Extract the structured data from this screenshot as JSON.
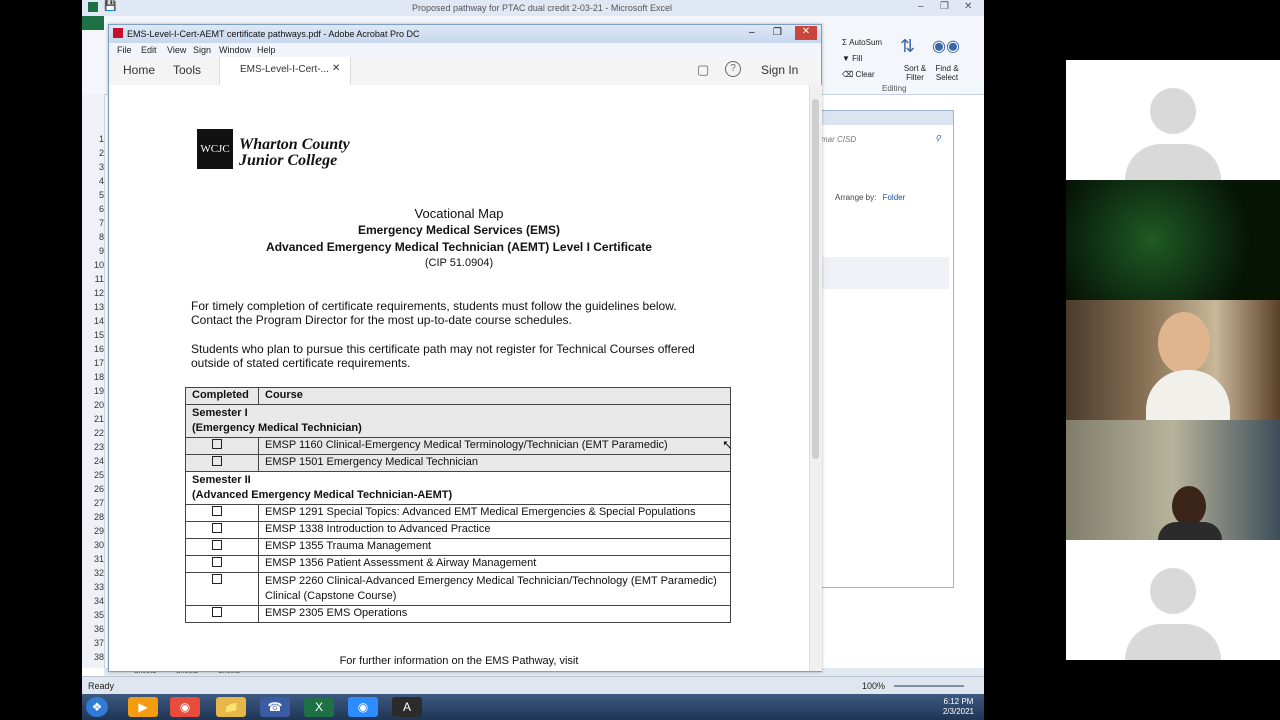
{
  "excel": {
    "title": "Proposed pathway for PTAC dual credit 2-03-21 - Microsoft Excel",
    "ribbon": {
      "autosum": "AutoSum",
      "fill": "Fill",
      "clear": "Clear",
      "sort_filter": "Sort & Filter",
      "find_select": "Find & Select",
      "group": "Editing"
    },
    "row_numbers": [
      "1",
      "2",
      "3",
      "4",
      "5",
      "6",
      "7",
      "8",
      "9",
      "10",
      "11",
      "12",
      "13",
      "14",
      "15",
      "16",
      "17",
      "18",
      "19",
      "20",
      "21",
      "22",
      "23",
      "24",
      "25",
      "26",
      "27",
      "28",
      "29",
      "30",
      "31",
      "32",
      "33",
      "34",
      "35",
      "36",
      "37",
      "38"
    ],
    "sheet_tabs": [
      "Sheet1",
      "Sheet2",
      "Sheet3"
    ],
    "status": "Ready",
    "zoom": "100%"
  },
  "side_panel": {
    "search_hint": "mar CISD",
    "arrange_by": "Arrange by:",
    "arrange_value": "Folder"
  },
  "acrobat": {
    "title": "EMS-Level-I-Cert-AEMT certificate pathways.pdf - Adobe Acrobat Pro DC",
    "menu": [
      "File",
      "Edit",
      "View",
      "Sign",
      "Window",
      "Help"
    ],
    "tabs": {
      "home": "Home",
      "tools": "Tools",
      "doc": "EMS-Level-I-Cert-..."
    },
    "sign_in": "Sign In"
  },
  "document": {
    "logo_letters": "WCJC",
    "college_line1": "Wharton County",
    "college_line2": "Junior College",
    "heading1": "Vocational Map",
    "heading2": "Emergency Medical Services (EMS)",
    "heading3": "Advanced Emergency Medical Technician (AEMT) Level I Certificate",
    "cip": "(CIP 51.0904)",
    "para1_line1": "For timely completion of certificate requirements, students must follow the guidelines below.",
    "para1_line2": "Contact the Program Director for the most up-to-date course schedules.",
    "para2_line1": "Students who plan to pursue this certificate path may not register for Technical Courses offered",
    "para2_line2": "outside of stated certificate requirements.",
    "table": {
      "col_completed": "Completed",
      "col_course": "Course",
      "sem1_line1": "Semester I",
      "sem1_line2": "(Emergency Medical Technician)",
      "sem1_courses": [
        "EMSP 1160 Clinical-Emergency Medical Terminology/Technician (EMT Paramedic)",
        "EMSP 1501 Emergency Medical Technician"
      ],
      "sem2_line1": "Semester II",
      "sem2_line2": "(Advanced Emergency Medical Technician-AEMT)",
      "sem2_courses": [
        "EMSP 1291 Special Topics: Advanced EMT Medical Emergencies & Special Populations",
        "EMSP 1338 Introduction to Advanced Practice",
        "EMSP 1355 Trauma Management",
        "EMSP 1356 Patient Assessment & Airway Management",
        "EMSP 2260 Clinical-Advanced Emergency Medical Technician/Technology (EMT Paramedic) Clinical (Capstone Course)",
        "EMSP 2305 EMS Operations"
      ]
    },
    "footer_text": "For further information on the EMS Pathway, visit"
  },
  "taskbar": {
    "time": "6:12 PM",
    "date": "2/3/2021"
  }
}
